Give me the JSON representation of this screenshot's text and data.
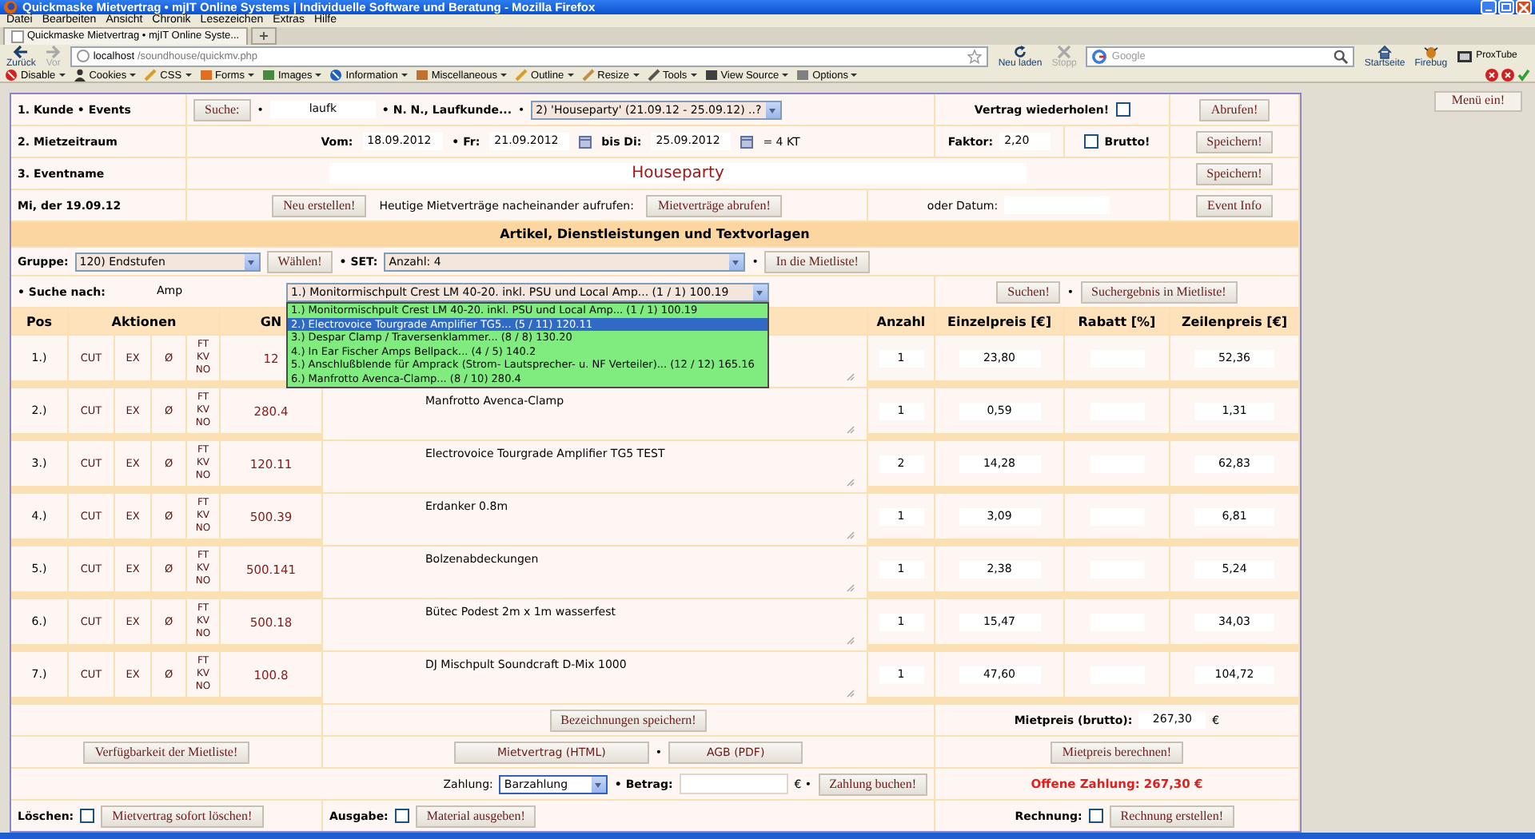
{
  "window": {
    "title": "Quickmaske Mietvertrag • mjIT Online Systems | Individuelle Software und Beratung - Mozilla Firefox"
  },
  "menu": [
    "Datei",
    "Bearbeiten",
    "Ansicht",
    "Chronik",
    "Lesezeichen",
    "Extras",
    "Hilfe"
  ],
  "tabs": [
    {
      "label": "Quickmaske Mietvertrag • mjIT Online Syste...",
      "selected": true
    }
  ],
  "new_tab": "+",
  "nav": {
    "back": {
      "label": "Zurück",
      "disabled": false
    },
    "forward": {
      "label": "Vor",
      "disabled": true
    },
    "url_host": "localhost",
    "url_path": "/soundhouse/quickmv.php",
    "reload": {
      "label": "Neu laden",
      "disabled": false
    },
    "stop": {
      "label": "Stopp",
      "disabled": true
    },
    "search_placeholder": "Google",
    "home": "Startseite",
    "firebug": "Firebug",
    "proxtube": "ProxTube"
  },
  "dev_toolbar": [
    "Disable",
    "Cookies",
    "CSS",
    "Forms",
    "Images",
    "Information",
    "Miscellaneous",
    "Outline",
    "Resize",
    "Tools",
    "View Source",
    "Options"
  ],
  "menu_button": "Menü ein!",
  "customer": {
    "label": "1. Kunde • Events",
    "search_button": "Suche:",
    "bullet": "•",
    "search_value": "laufk",
    "customer_name": "• N. N., Laufkunde...",
    "bullet2": "•",
    "event_select": "2) 'Houseparty' (21.09.12 - 25.09.12) ..?",
    "repeat_label": "Vertrag wiederholen!",
    "repeat_checked": false,
    "fetch_button": "Abrufen!"
  },
  "period": {
    "label": "2. Mietzeitraum",
    "from_label": "Vom:",
    "from_value": "18.09.2012",
    "fr_label": "• Fr:",
    "fr_value": "21.09.2012",
    "to_label": "bis Di:",
    "to_value": "25.09.2012",
    "duration": "= 4 KT",
    "factor_label": "Faktor:",
    "factor_value": "2,20",
    "brutto_label": "Brutto!",
    "brutto_checked": false,
    "save_button": "Speichern!"
  },
  "event": {
    "label": "3. Eventname",
    "name": "Houseparty",
    "save_button": "Speichern!"
  },
  "day": {
    "label": "Mi, der 19.09.12",
    "new_button": "Neu erstellen!",
    "hint": "Heutige Mietverträge nacheinander aufrufen:",
    "fetch_button": "Mietverträge abrufen!",
    "date_label": "oder Datum:",
    "info_button": "Event Info"
  },
  "section_title": "Artikel, Dienstleistungen und Textvorlagen",
  "group": {
    "label": "Gruppe:",
    "select": "120) Endstufen",
    "choose_button": "Wählen!",
    "set_label": "• SET:",
    "set_select": "Anzahl: 4",
    "bullet": "•",
    "add_button": "In die Mietliste!"
  },
  "search": {
    "label": "• Suche nach:",
    "value": "Amp",
    "select": "1.) Monitormischpult Crest LM 40-20. inkl. PSU und Local Amp... (1 / 1) 100.19",
    "find_button": "Suchen!",
    "bullet": "•",
    "add_results_button": "Suchergebnis in Mietliste!",
    "options": [
      {
        "label": "1.) Monitormischpult Crest LM 40-20. inkl. PSU und Local Amp... (1 / 1) 100.19",
        "selected": false
      },
      {
        "label": "2.) Electrovoice Tourgrade Amplifier TG5... (5 / 11) 120.11",
        "selected": true
      },
      {
        "label": "3.) Despar Clamp / Traversenklammer... (8 / 8) 130.20",
        "selected": false
      },
      {
        "label": "4.) In Ear Fischer Amps Bellpack... (4 / 5) 140.2",
        "selected": false
      },
      {
        "label": "5.) Anschlußblende für Amprack (Strom- Lautsprecher- u. NF Verteiler)... (12 / 12) 165.16",
        "selected": false
      },
      {
        "label": "6.) Manfrotto Avenca-Clamp... (8 / 10) 280.4",
        "selected": false
      }
    ]
  },
  "table": {
    "columns": [
      "Pos",
      "Aktionen",
      "GN",
      "Anzahl",
      "Einzelpreis [€]",
      "Rabatt [%]",
      "Zeilenpreis [€]"
    ],
    "rows": [
      {
        "pos": "1.)",
        "actions": [
          "CUT",
          "EX",
          "Ø"
        ],
        "flags": [
          "FT",
          "KV",
          "NO"
        ],
        "gnr": "12",
        "quantity": "1",
        "unit_price": "23,80",
        "line_price": "52,36"
      },
      {
        "pos": "2.)",
        "actions": [
          "CUT",
          "EX",
          "Ø"
        ],
        "flags": [
          "FT",
          "KV",
          "NO"
        ],
        "gnr": "280.4",
        "description": "Manfrotto Avenca-Clamp",
        "quantity": "1",
        "unit_price": "0,59",
        "line_price": "1,31"
      },
      {
        "pos": "3.)",
        "actions": [
          "CUT",
          "EX",
          "Ø"
        ],
        "flags": [
          "FT",
          "KV",
          "NO"
        ],
        "gnr": "120.11",
        "description": "Electrovoice Tourgrade Amplifier TG5 TEST",
        "quantity": "2",
        "unit_price": "14,28",
        "line_price": "62,83"
      },
      {
        "pos": "4.)",
        "actions": [
          "CUT",
          "EX",
          "Ø"
        ],
        "flags": [
          "FT",
          "KV",
          "NO"
        ],
        "gnr": "500.39",
        "description": "Erdanker 0.8m",
        "quantity": "1",
        "unit_price": "3,09",
        "line_price": "6,81"
      },
      {
        "pos": "5.)",
        "actions": [
          "CUT",
          "EX",
          "Ø"
        ],
        "flags": [
          "FT",
          "KV",
          "NO"
        ],
        "gnr": "500.141",
        "description": "Bolzenabdeckungen",
        "quantity": "1",
        "unit_price": "2,38",
        "line_price": "5,24"
      },
      {
        "pos": "6.)",
        "actions": [
          "CUT",
          "EX",
          "Ø"
        ],
        "flags": [
          "FT",
          "KV",
          "NO"
        ],
        "gnr": "500.18",
        "description": "Bütec Podest 2m x 1m wasserfest",
        "quantity": "1",
        "unit_price": "15,47",
        "line_price": "34,03"
      },
      {
        "pos": "7.)",
        "actions": [
          "CUT",
          "EX",
          "Ø"
        ],
        "flags": [
          "FT",
          "KV",
          "NO"
        ],
        "gnr": "100.8",
        "description": "DJ Mischpult Soundcraft D-Mix 1000",
        "quantity": "1",
        "unit_price": "47,60",
        "line_price": "104,72"
      }
    ]
  },
  "footer": {
    "save_descriptions_button": "Bezeichnungen speichern!",
    "rent_label": "Mietpreis (brutto):",
    "rent_value": "267,30",
    "rent_currency": "€",
    "availability_button": "Verfügbarkeit der Mietliste!",
    "contract_button": "Mietvertrag (HTML)",
    "bullet": "•",
    "agb_button": "AGB (PDF)",
    "calc_button": "Mietpreis berechnen!",
    "payment_label": "Zahlung:",
    "payment_select": "Barzahlung",
    "amount_label": "• Betrag:",
    "amount_currency": "€ •",
    "book_button": "Zahlung buchen!",
    "open_payment": "Offene Zahlung: 267,30 €",
    "delete_label": "Löschen:",
    "delete_checked": false,
    "delete_button": "Mietvertrag sofort löschen!",
    "issue_label": "Ausgabe:",
    "issue_checked": false,
    "issue_button": "Material ausgeben!",
    "invoice_label": "Rechnung:",
    "invoice_checked": false,
    "invoice_button": "Rechnung erstellen!"
  }
}
